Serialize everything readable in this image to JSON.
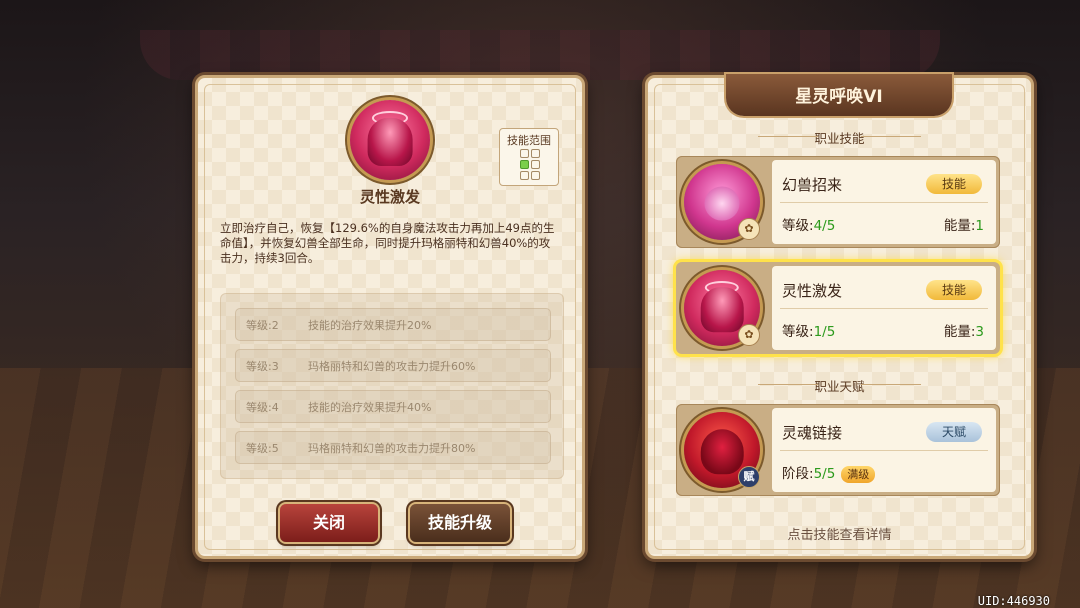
{
  "detail": {
    "skill_name": "灵性激发",
    "range_label": "技能范围",
    "range_grid": [
      false,
      false,
      true,
      false,
      false,
      false
    ],
    "description": "立即治疗自己，恢复【129.6%的自身魔法攻击力再加上49点的生命值】，并恢复幻兽全部生命，同时提升玛格丽特和幻兽40%的攻击力，持续3回合。",
    "levels": [
      {
        "level": "等级:2",
        "effect": "技能的治疗效果提升20%"
      },
      {
        "level": "等级:3",
        "effect": "玛格丽特和幻兽的攻击力提升60%"
      },
      {
        "level": "等级:4",
        "effect": "技能的治疗效果提升40%"
      },
      {
        "level": "等级:5",
        "effect": "玛格丽特和幻兽的攻击力提升80%"
      }
    ],
    "close_label": "关闭",
    "upgrade_label": "技能升级"
  },
  "class_panel": {
    "title": "星灵呼唤VI",
    "skills_section": "职业技能",
    "talent_section": "职业天赋",
    "skills": [
      {
        "name": "幻兽招来",
        "tag": "技能",
        "level_label": "等级:",
        "level": "4/5",
        "energy_label": "能量:",
        "energy": "1"
      },
      {
        "name": "灵性激发",
        "tag": "技能",
        "level_label": "等级:",
        "level": "1/5",
        "energy_label": "能量:",
        "energy": "3"
      }
    ],
    "talent": {
      "name": "灵魂链接",
      "tag": "天赋",
      "stage_label": "阶段:",
      "stage": "5/5",
      "maxed_label": "满级",
      "badge": "赋"
    },
    "hint": "点击技能查看详情"
  },
  "uid": "UID:446930",
  "colors": {
    "accent_gold": "#f1b93a",
    "level_green": "#2c9a1c",
    "selected_glow": "#ffe24a"
  }
}
